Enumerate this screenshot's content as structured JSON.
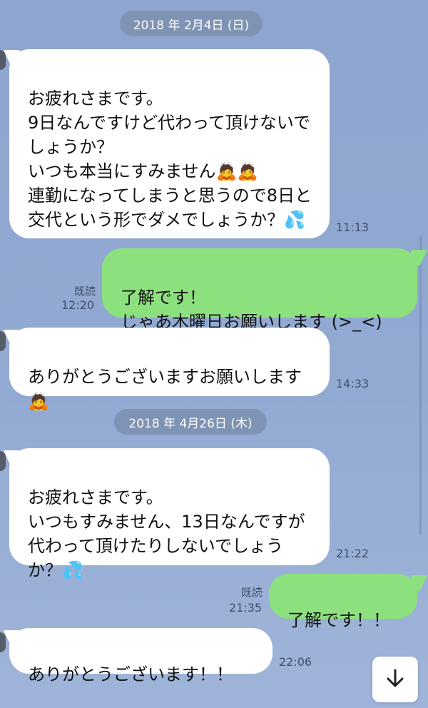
{
  "dates": [
    "2018 年 2月4日 (日)",
    "2018 年 4月26日 (木)"
  ],
  "messages": [
    {
      "side": "in",
      "text": "お疲れさまです。\n9日なんですけど代わって頂けないでしょうか？\nいつも本当にすみません🙇🙇\n連勤になってしまうと思うので8日と交代という形でダメでしょうか？💦",
      "time": "11:13"
    },
    {
      "side": "out",
      "text": "了解です！\nじゃあ木曜日お願いします (>_<)",
      "time": "12:20",
      "read": "既読"
    },
    {
      "side": "in",
      "text": "ありがとうございますお願いします🙇",
      "time": "14:33"
    },
    {
      "side": "in",
      "text": "お疲れさまです。\nいつもすみません、13日なんですが代わって頂けたりしないでしょうか？💦",
      "time": "21:22"
    },
    {
      "side": "out",
      "text": "了解です！！",
      "time": "21:35",
      "read": "既読"
    },
    {
      "side": "in",
      "text": "ありがとうございます！！",
      "time": "22:06"
    }
  ],
  "icons": {
    "scroll_down": "arrow-down-icon"
  }
}
